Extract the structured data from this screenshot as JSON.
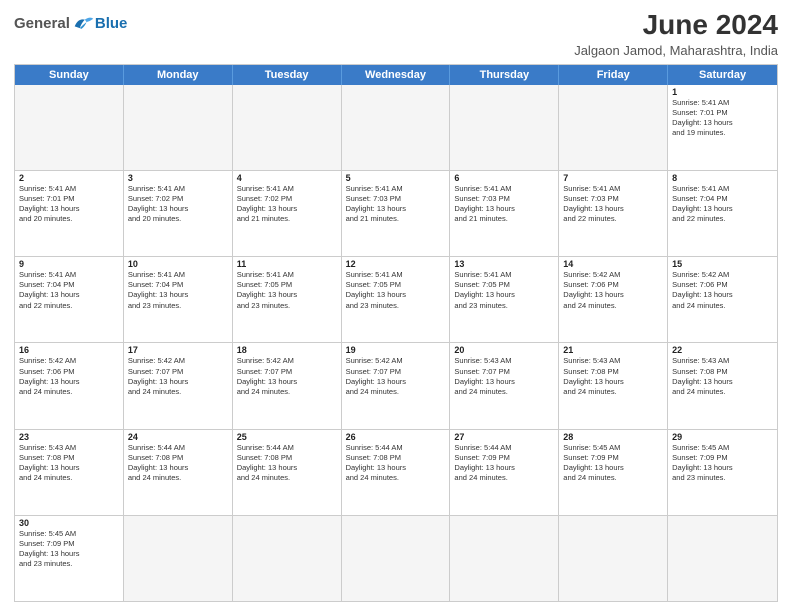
{
  "header": {
    "logo_general": "General",
    "logo_blue": "Blue",
    "month_title": "June 2024",
    "location": "Jalgaon Jamod, Maharashtra, India"
  },
  "days_of_week": [
    "Sunday",
    "Monday",
    "Tuesday",
    "Wednesday",
    "Thursday",
    "Friday",
    "Saturday"
  ],
  "weeks": [
    [
      {
        "day": "",
        "info": ""
      },
      {
        "day": "",
        "info": ""
      },
      {
        "day": "",
        "info": ""
      },
      {
        "day": "",
        "info": ""
      },
      {
        "day": "",
        "info": ""
      },
      {
        "day": "",
        "info": ""
      },
      {
        "day": "1",
        "info": "Sunrise: 5:41 AM\nSunset: 7:01 PM\nDaylight: 13 hours\nand 19 minutes."
      }
    ],
    [
      {
        "day": "2",
        "info": "Sunrise: 5:41 AM\nSunset: 7:01 PM\nDaylight: 13 hours\nand 20 minutes."
      },
      {
        "day": "3",
        "info": "Sunrise: 5:41 AM\nSunset: 7:02 PM\nDaylight: 13 hours\nand 20 minutes."
      },
      {
        "day": "4",
        "info": "Sunrise: 5:41 AM\nSunset: 7:02 PM\nDaylight: 13 hours\nand 21 minutes."
      },
      {
        "day": "5",
        "info": "Sunrise: 5:41 AM\nSunset: 7:03 PM\nDaylight: 13 hours\nand 21 minutes."
      },
      {
        "day": "6",
        "info": "Sunrise: 5:41 AM\nSunset: 7:03 PM\nDaylight: 13 hours\nand 21 minutes."
      },
      {
        "day": "7",
        "info": "Sunrise: 5:41 AM\nSunset: 7:03 PM\nDaylight: 13 hours\nand 22 minutes."
      },
      {
        "day": "8",
        "info": "Sunrise: 5:41 AM\nSunset: 7:04 PM\nDaylight: 13 hours\nand 22 minutes."
      }
    ],
    [
      {
        "day": "9",
        "info": "Sunrise: 5:41 AM\nSunset: 7:04 PM\nDaylight: 13 hours\nand 22 minutes."
      },
      {
        "day": "10",
        "info": "Sunrise: 5:41 AM\nSunset: 7:04 PM\nDaylight: 13 hours\nand 23 minutes."
      },
      {
        "day": "11",
        "info": "Sunrise: 5:41 AM\nSunset: 7:05 PM\nDaylight: 13 hours\nand 23 minutes."
      },
      {
        "day": "12",
        "info": "Sunrise: 5:41 AM\nSunset: 7:05 PM\nDaylight: 13 hours\nand 23 minutes."
      },
      {
        "day": "13",
        "info": "Sunrise: 5:41 AM\nSunset: 7:05 PM\nDaylight: 13 hours\nand 23 minutes."
      },
      {
        "day": "14",
        "info": "Sunrise: 5:42 AM\nSunset: 7:06 PM\nDaylight: 13 hours\nand 24 minutes."
      },
      {
        "day": "15",
        "info": "Sunrise: 5:42 AM\nSunset: 7:06 PM\nDaylight: 13 hours\nand 24 minutes."
      }
    ],
    [
      {
        "day": "16",
        "info": "Sunrise: 5:42 AM\nSunset: 7:06 PM\nDaylight: 13 hours\nand 24 minutes."
      },
      {
        "day": "17",
        "info": "Sunrise: 5:42 AM\nSunset: 7:07 PM\nDaylight: 13 hours\nand 24 minutes."
      },
      {
        "day": "18",
        "info": "Sunrise: 5:42 AM\nSunset: 7:07 PM\nDaylight: 13 hours\nand 24 minutes."
      },
      {
        "day": "19",
        "info": "Sunrise: 5:42 AM\nSunset: 7:07 PM\nDaylight: 13 hours\nand 24 minutes."
      },
      {
        "day": "20",
        "info": "Sunrise: 5:43 AM\nSunset: 7:07 PM\nDaylight: 13 hours\nand 24 minutes."
      },
      {
        "day": "21",
        "info": "Sunrise: 5:43 AM\nSunset: 7:08 PM\nDaylight: 13 hours\nand 24 minutes."
      },
      {
        "day": "22",
        "info": "Sunrise: 5:43 AM\nSunset: 7:08 PM\nDaylight: 13 hours\nand 24 minutes."
      }
    ],
    [
      {
        "day": "23",
        "info": "Sunrise: 5:43 AM\nSunset: 7:08 PM\nDaylight: 13 hours\nand 24 minutes."
      },
      {
        "day": "24",
        "info": "Sunrise: 5:44 AM\nSunset: 7:08 PM\nDaylight: 13 hours\nand 24 minutes."
      },
      {
        "day": "25",
        "info": "Sunrise: 5:44 AM\nSunset: 7:08 PM\nDaylight: 13 hours\nand 24 minutes."
      },
      {
        "day": "26",
        "info": "Sunrise: 5:44 AM\nSunset: 7:08 PM\nDaylight: 13 hours\nand 24 minutes."
      },
      {
        "day": "27",
        "info": "Sunrise: 5:44 AM\nSunset: 7:09 PM\nDaylight: 13 hours\nand 24 minutes."
      },
      {
        "day": "28",
        "info": "Sunrise: 5:45 AM\nSunset: 7:09 PM\nDaylight: 13 hours\nand 24 minutes."
      },
      {
        "day": "29",
        "info": "Sunrise: 5:45 AM\nSunset: 7:09 PM\nDaylight: 13 hours\nand 23 minutes."
      }
    ],
    [
      {
        "day": "30",
        "info": "Sunrise: 5:45 AM\nSunset: 7:09 PM\nDaylight: 13 hours\nand 23 minutes."
      },
      {
        "day": "",
        "info": ""
      },
      {
        "day": "",
        "info": ""
      },
      {
        "day": "",
        "info": ""
      },
      {
        "day": "",
        "info": ""
      },
      {
        "day": "",
        "info": ""
      },
      {
        "day": "",
        "info": ""
      }
    ]
  ]
}
